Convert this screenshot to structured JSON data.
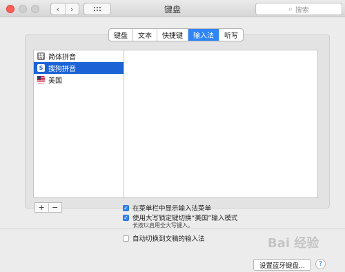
{
  "window": {
    "title": "键盘"
  },
  "toolbar": {
    "back": "‹",
    "forward": "›",
    "search_placeholder": "搜索"
  },
  "tabs": [
    {
      "label": "键盘",
      "active": false
    },
    {
      "label": "文本",
      "active": false
    },
    {
      "label": "快捷键",
      "active": false
    },
    {
      "label": "输入法",
      "active": true
    },
    {
      "label": "听写",
      "active": false
    }
  ],
  "input_sources": [
    {
      "label": "简体拼音",
      "icon": "pinyin-icon",
      "selected": false
    },
    {
      "label": "搜狗拼音",
      "icon": "sogou-icon",
      "selected": true
    },
    {
      "label": "美国",
      "icon": "us-flag-icon",
      "selected": false
    }
  ],
  "list_controls": {
    "add": "+",
    "remove": "−"
  },
  "options": {
    "show_menu": {
      "label": "在菜单栏中显示输入法菜单",
      "checked": true
    },
    "caps_lock": {
      "label": "使用大写锁定键切换“美国”输入模式",
      "checked": true
    },
    "caps_lock_hint": "长按以启用全大写键入。",
    "auto_switch": {
      "label": "自动切换到文稿的输入法",
      "checked": false
    }
  },
  "footer": {
    "bluetooth_button": "设置蓝牙键盘...",
    "help": "?"
  },
  "watermark": "Bai 经验"
}
